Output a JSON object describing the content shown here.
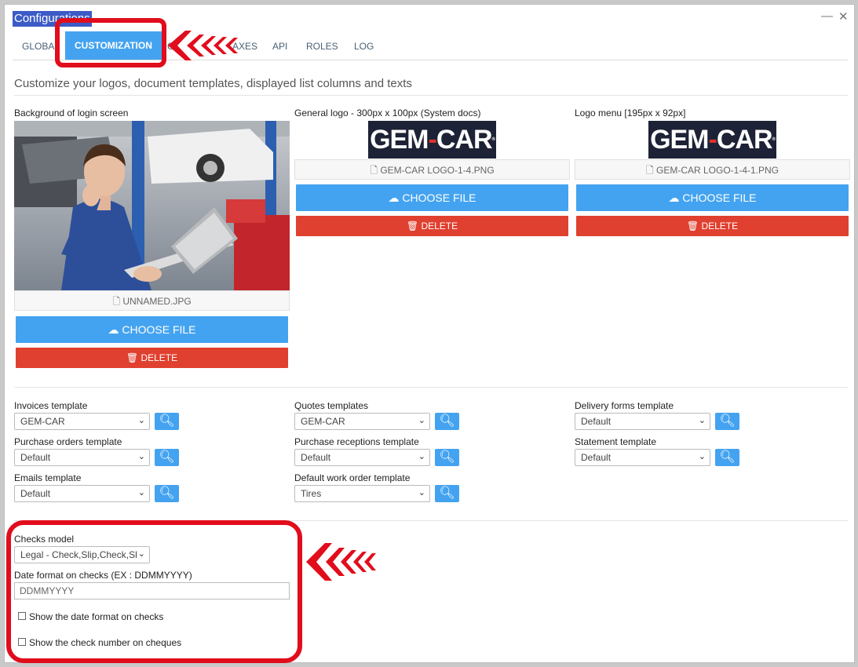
{
  "window": {
    "title": "Configurations",
    "minimize": "—",
    "close": "✕"
  },
  "tabs": [
    "GLOBAL",
    "CUSTOMIZATION",
    "C",
    "AXES",
    "API",
    "ROLES",
    "LOG"
  ],
  "subtitle": "Customize your logos, document templates, displayed list columns and texts",
  "uploads": [
    {
      "label": "Background of login screen",
      "file": "UNNAMED.JPG",
      "choose": "CHOOSE FILE",
      "delete": "DELETE"
    },
    {
      "label": "General logo - 300px x 100px (System docs)",
      "file": "GEM-CAR LOGO-1-4.PNG",
      "choose": "CHOOSE FILE",
      "delete": "DELETE"
    },
    {
      "label": "Logo menu [195px x 92px]",
      "file": "GEM-CAR LOGO-1-4-1.PNG",
      "choose": "CHOOSE FILE",
      "delete": "DELETE"
    }
  ],
  "logo": {
    "text_left": "GEM",
    "text_dash": "-",
    "text_right": "CAR"
  },
  "templates": [
    {
      "label": "Invoices template",
      "value": "GEM-CAR"
    },
    {
      "label": "Quotes templates",
      "value": "GEM-CAR"
    },
    {
      "label": "Delivery forms template",
      "value": "Default"
    },
    {
      "label": "Purchase orders template",
      "value": "Default"
    },
    {
      "label": "Purchase receptions template",
      "value": "Default"
    },
    {
      "label": "Statement template",
      "value": "Default"
    },
    {
      "label": "Emails template",
      "value": "Default"
    },
    {
      "label": "Default work order template",
      "value": "Tires"
    }
  ],
  "checks": {
    "model_label": "Checks model",
    "model_value": "Legal - Check,Slip,Check,Sl",
    "date_label": "Date format on checks (EX : DDMMYYYY)",
    "date_value": "DDMMYYYY",
    "show_date": "Show the date format on checks",
    "show_number": "Show the check number on cheques"
  },
  "icons": {
    "file": "file-icon",
    "upload": "cloud-upload-icon",
    "trash": "trash-icon",
    "search": "search-icon",
    "chevron": "chevron-down-icon"
  },
  "colors": {
    "accent": "#44a3f0",
    "danger": "#e0402f",
    "annotation": "#e10d1c"
  }
}
